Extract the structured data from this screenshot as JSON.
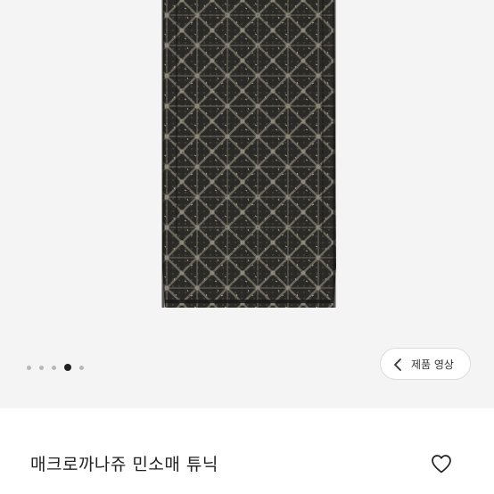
{
  "gallery": {
    "image_alt": "black tweed sleeveless tunic",
    "pager": {
      "total": 5,
      "active": 3
    }
  },
  "video_button": {
    "label": "제품 영상",
    "icon": "chevron-left-icon"
  },
  "product": {
    "name": "매크로까나쥬 민소매 튜닉"
  },
  "wishlist": {
    "icon": "heart-outline-icon"
  },
  "colors": {
    "gallery_bg": "#f4f4f4",
    "dot_inactive": "#b8b8b8",
    "dot_active": "#222222",
    "text": "#222222"
  }
}
